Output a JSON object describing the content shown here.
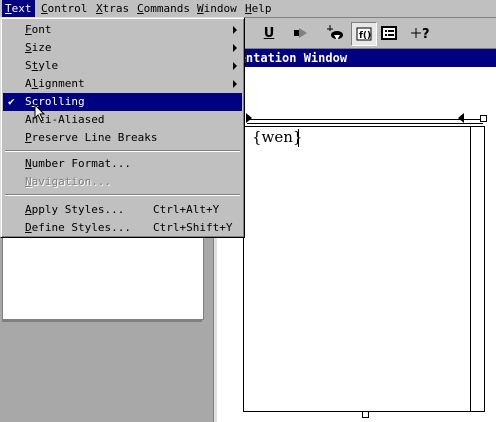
{
  "menubar": {
    "items": [
      {
        "label": "Text",
        "ul": "T"
      },
      {
        "label": "Control",
        "ul": "C"
      },
      {
        "label": "Xtras",
        "ul": "X"
      },
      {
        "label": "Commands",
        "ul": "C"
      },
      {
        "label": "Window",
        "ul": "W"
      },
      {
        "label": "Help",
        "ul": "H"
      }
    ]
  },
  "toolbar": {
    "underline_label": "U",
    "buttons": [
      "underline-icon",
      "play-icon",
      "filter-icon",
      "field-icon",
      "list-icon",
      "help-cursor-icon"
    ]
  },
  "presentation": {
    "title": "resentation Window",
    "text": "{wen}"
  },
  "text_menu": {
    "items": [
      {
        "first": "F",
        "rest": "ont",
        "submenu": true
      },
      {
        "first": "S",
        "rest": "ize",
        "submenu": true
      },
      {
        "first": "S",
        "rest": "tyle",
        "submenu": true
      },
      {
        "first": "A",
        "rest": "lignment",
        "submenu": true,
        "ul_index": 1
      },
      {
        "first": "S",
        "rest": "crolling",
        "checked": true,
        "selected": true
      },
      {
        "first": "Ant",
        "rest": "i-Aliased"
      },
      {
        "first": "P",
        "rest": "reserve Line Breaks"
      },
      {
        "first": "N",
        "rest": "umber Format..."
      },
      {
        "first": "N",
        "rest": "avigation...",
        "disabled": true
      },
      {
        "first": "A",
        "rest": "pply Styles...",
        "shortcut": "Ctrl+Alt+Y"
      },
      {
        "first": "D",
        "rest": "efine Styles...",
        "shortcut": "Ctrl+Shift+Y"
      }
    ],
    "check_mark": "✔"
  },
  "colors": {
    "menu_bg": "#c0c0c0",
    "highlight": "#000080",
    "title_bar": "#000080"
  }
}
